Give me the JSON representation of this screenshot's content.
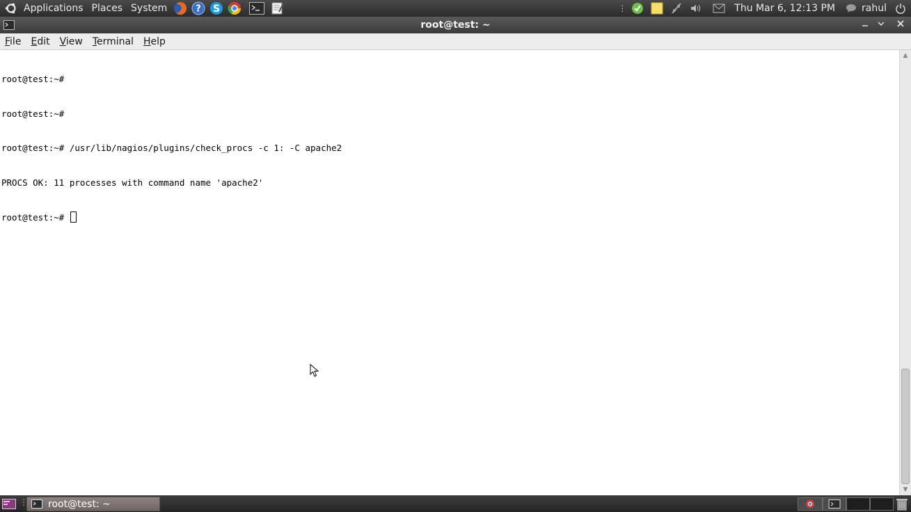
{
  "top_panel": {
    "menus": [
      "Applications",
      "Places",
      "System"
    ],
    "clock": "Thu Mar  6, 12:13 PM",
    "user": "rahul",
    "launchers": [
      "firefox-icon",
      "help-icon",
      "skype-icon",
      "chrome-icon",
      "terminal-icon",
      "text-editor-icon"
    ]
  },
  "window": {
    "title": "root@test: ~"
  },
  "menubar": {
    "items": [
      {
        "accel": "F",
        "rest": "ile"
      },
      {
        "accel": "E",
        "rest": "dit"
      },
      {
        "accel": "V",
        "rest": "iew"
      },
      {
        "accel": "T",
        "rest": "erminal"
      },
      {
        "accel": "H",
        "rest": "elp"
      }
    ]
  },
  "terminal": {
    "lines": [
      "root@test:~#",
      "root@test:~#",
      "root@test:~# /usr/lib/nagios/plugins/check_procs -c 1: -C apache2",
      "PROCS OK: 11 processes with command name 'apache2'"
    ],
    "prompt": "root@test:~# "
  },
  "taskbar": {
    "task_label": "root@test: ~"
  }
}
